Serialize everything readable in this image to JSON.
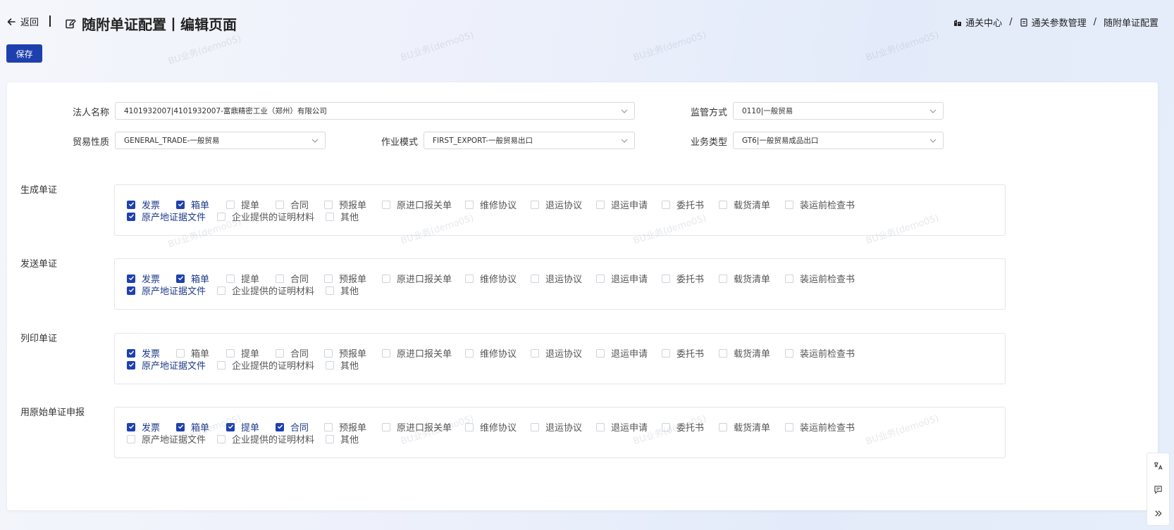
{
  "header": {
    "back_label": "返回",
    "title": "随附单证配置丨编辑页面",
    "breadcrumb": [
      "通关中心",
      "通关参数管理",
      "随附单证配置"
    ],
    "save_label": "保存"
  },
  "watermark_text": "BU业务(demo05)",
  "form": {
    "legal_name": {
      "label": "法人名称",
      "value": "4101932007|4101932007-富鼎精密工业（郑州）有限公司"
    },
    "supervision": {
      "label": "监管方式",
      "value": "0110|一般贸易"
    },
    "trade_nature": {
      "label": "贸易性质",
      "value": "GENERAL_TRADE-一般贸易"
    },
    "operation_mode": {
      "label": "作业模式",
      "value": "FIRST_EXPORT-一般贸易出口"
    },
    "business_type": {
      "label": "业务类型",
      "value": "GT6|一般贸易成品出口"
    }
  },
  "doc_options": [
    "发票",
    "箱单",
    "提单",
    "合同",
    "预报单",
    "原进口报关单",
    "维修协议",
    "退运协议",
    "退运申请",
    "委托书",
    "载货清单",
    "装运前检查书",
    "原产地证据文件",
    "企业提供的证明材料",
    "其他"
  ],
  "sections": [
    {
      "label": "生成单证",
      "checked": [
        true,
        true,
        false,
        false,
        false,
        false,
        false,
        false,
        false,
        false,
        false,
        false,
        true,
        false,
        false
      ]
    },
    {
      "label": "发送单证",
      "checked": [
        true,
        true,
        false,
        false,
        false,
        false,
        false,
        false,
        false,
        false,
        false,
        false,
        true,
        false,
        false
      ]
    },
    {
      "label": "列印单证",
      "checked": [
        true,
        false,
        false,
        false,
        false,
        false,
        false,
        false,
        false,
        false,
        false,
        false,
        true,
        false,
        false
      ]
    },
    {
      "label": "用原始单证申报",
      "checked": [
        true,
        true,
        true,
        true,
        false,
        false,
        false,
        false,
        false,
        false,
        false,
        false,
        false,
        false,
        false
      ]
    }
  ],
  "colors": {
    "primary": "#1e40af"
  },
  "icons": {
    "back": "arrow-left-icon",
    "edit": "edit-icon",
    "bc1": "building-icon",
    "bc2": "document-icon",
    "tools": [
      "translate-icon",
      "message-icon",
      "double-chevron-right-icon"
    ]
  }
}
